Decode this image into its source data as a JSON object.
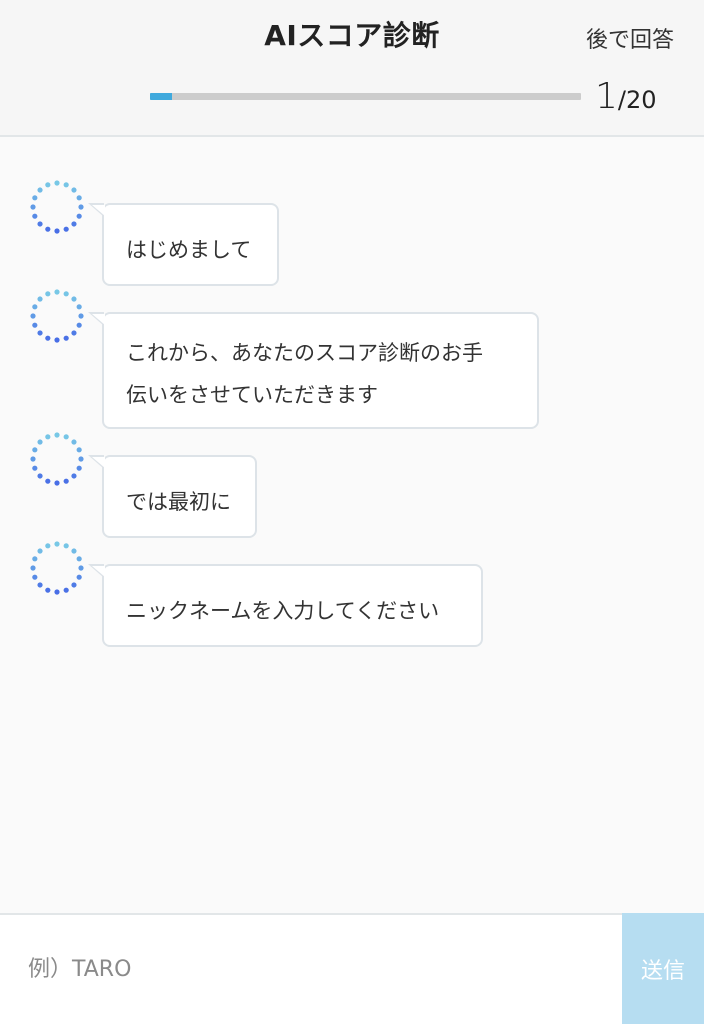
{
  "header": {
    "title": "AIスコア診断",
    "later_label": "後で回答",
    "progress": {
      "current": "1",
      "total": "/20",
      "fraction": 0.05,
      "color": "#3fa9dd"
    }
  },
  "messages": [
    {
      "avatar_icon": "dotted-circle-avatar-icon",
      "lines": [
        "はじめまして"
      ]
    },
    {
      "avatar_icon": "dotted-circle-avatar-icon",
      "lines": [
        "これから、あなたのスコア診断のお手",
        "伝いをさせていただきます"
      ]
    },
    {
      "avatar_icon": "dotted-circle-avatar-icon",
      "lines": [
        "では最初に"
      ]
    },
    {
      "avatar_icon": "dotted-circle-avatar-icon",
      "lines": [
        "ニックネームを入力してください"
      ]
    }
  ],
  "composer": {
    "placeholder": "例）TARO",
    "value": "",
    "send_label": "送信",
    "send_color": "#b6ddf1"
  }
}
